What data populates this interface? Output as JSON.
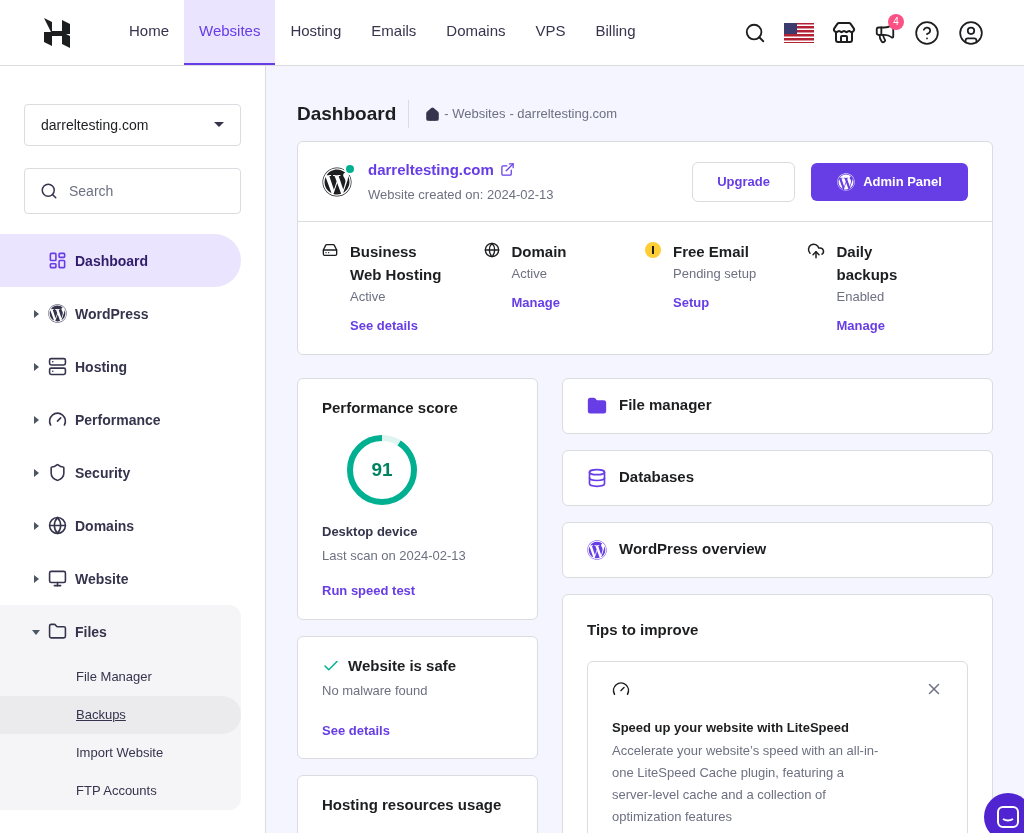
{
  "nav": {
    "tabs": [
      {
        "label": "Home",
        "selected": false
      },
      {
        "label": "Websites",
        "selected": true
      },
      {
        "label": "Hosting",
        "selected": false
      },
      {
        "label": "Emails",
        "selected": false
      },
      {
        "label": "Domains",
        "selected": false
      },
      {
        "label": "VPS",
        "selected": false
      },
      {
        "label": "Billing",
        "selected": false
      }
    ],
    "notification_count": "4"
  },
  "sidebar": {
    "site_select": "darreltesting.com",
    "search": {
      "placeholder": "Search"
    },
    "items": [
      {
        "label": "Dashboard",
        "selected": true,
        "expanded": false
      },
      {
        "label": "WordPress",
        "selected": false,
        "expanded": false
      },
      {
        "label": "Hosting",
        "selected": false,
        "expanded": false
      },
      {
        "label": "Performance",
        "selected": false,
        "expanded": false
      },
      {
        "label": "Security",
        "selected": false,
        "expanded": false
      },
      {
        "label": "Domains",
        "selected": false,
        "expanded": false
      },
      {
        "label": "Website",
        "selected": false,
        "expanded": false
      },
      {
        "label": "Files",
        "selected": false,
        "expanded": true,
        "children": [
          {
            "label": "File Manager",
            "selected": false
          },
          {
            "label": "Backups",
            "selected": true
          },
          {
            "label": "Import Website",
            "selected": false
          },
          {
            "label": "FTP Accounts",
            "selected": false
          }
        ]
      }
    ]
  },
  "page": {
    "title": "Dashboard",
    "breadcrumb": [
      "- Websites",
      "- darreltesting.com"
    ]
  },
  "site_card": {
    "domain": "darreltesting.com",
    "online": true,
    "created": "Website created on: 2024-02-13",
    "upgrade_button": "Upgrade",
    "admin_button": "Admin Panel",
    "services": [
      {
        "kind": "hosting",
        "title": "Business Web Hosting",
        "status": "Active",
        "link": "See details"
      },
      {
        "kind": "domain",
        "title": "Domain",
        "status": "Active",
        "link": "Manage"
      },
      {
        "kind": "warning",
        "title": "Free Email",
        "status": "Pending setup",
        "link": "Setup"
      },
      {
        "kind": "backup",
        "title": "Daily backups",
        "status": "Enabled",
        "link": "Manage"
      }
    ]
  },
  "performance": {
    "title": "Performance score",
    "score": "91",
    "level": 0.91,
    "device": "Desktop device",
    "last_scan": "Last scan on 2024-02-13",
    "link": "Run speed test"
  },
  "safety": {
    "title": "Website is safe",
    "status": "No malware found",
    "link": "See details"
  },
  "resources": {
    "title": "Hosting resources usage"
  },
  "shortcuts": [
    {
      "kind": "folder",
      "label": "File manager"
    },
    {
      "kind": "database",
      "label": "Databases"
    },
    {
      "kind": "wordpress",
      "label": "WordPress overview"
    }
  ],
  "tips": {
    "title": "Tips to improve",
    "tip_title": "Speed up your website with LiteSpeed",
    "tip_lines": [
      "Accelerate your website’s speed with an all-in-",
      "one LiteSpeed Cache plugin, featuring a",
      "server-level cache and a collection of",
      "optimization features"
    ]
  }
}
